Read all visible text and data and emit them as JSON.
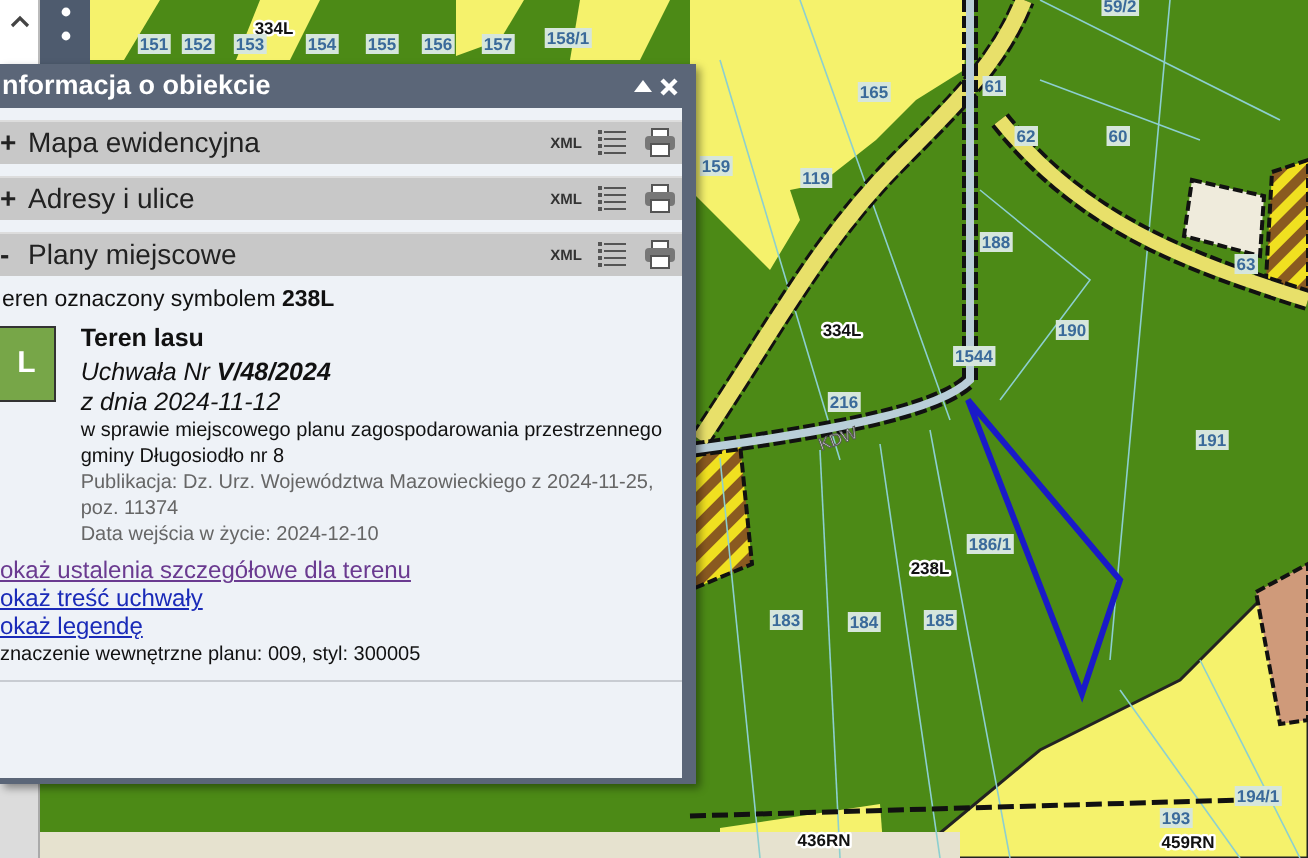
{
  "panel": {
    "title": "nformacja o obiekcie",
    "sections": [
      {
        "toggle": "+",
        "title": "Mapa ewidencyjna",
        "xml": "XML"
      },
      {
        "toggle": "+",
        "title": "Adresy i ulice",
        "xml": "XML"
      },
      {
        "toggle": "-",
        "title": "Plany miejscowe",
        "xml": "XML",
        "content": {
          "intro": "eren oznaczony symbolem **238L**",
          "symbol": "L",
          "name": "Teren lasu",
          "resolution": "Uchwała Nr **V/48/2024**",
          "date": "z dnia 2024-11-12",
          "subject": "w sprawie miejscowego planu zagospodarowania przestrzennego gminy Długosiodło nr 8",
          "publication": "Publikacja: Dz. Urz. Województwa Mazowieckiego z 2024-11-25, poz. 11374",
          "in_force": "Data wejścia w życie: 2024-12-10",
          "links": [
            {
              "text": "okaż ustalenia szczegółowe dla terenu",
              "visited": true
            },
            {
              "text": "okaż treść uchwały",
              "visited": false
            },
            {
              "text": "okaż legendę",
              "visited": false
            }
          ],
          "note": "znaczenie wewnętrzne planu: 009, styl: 300005"
        }
      }
    ]
  },
  "map": {
    "labels": [
      {
        "text": "334L",
        "kind": "zone"
      },
      {
        "text": "151",
        "kind": "parcel"
      },
      {
        "text": "152",
        "kind": "parcel"
      },
      {
        "text": "153",
        "kind": "parcel"
      },
      {
        "text": "154",
        "kind": "parcel"
      },
      {
        "text": "155",
        "kind": "parcel"
      },
      {
        "text": "156",
        "kind": "parcel"
      },
      {
        "text": "157",
        "kind": "parcel"
      },
      {
        "text": "158/1",
        "kind": "parcel"
      },
      {
        "text": "59/2",
        "kind": "parcel"
      },
      {
        "text": "165",
        "kind": "parcel"
      },
      {
        "text": "61",
        "kind": "parcel"
      },
      {
        "text": "62",
        "kind": "parcel"
      },
      {
        "text": "60",
        "kind": "parcel"
      },
      {
        "text": "159",
        "kind": "parcel"
      },
      {
        "text": "119",
        "kind": "parcel"
      },
      {
        "text": "63",
        "kind": "parcel"
      },
      {
        "text": "188",
        "kind": "parcel"
      },
      {
        "text": "334L",
        "kind": "zone"
      },
      {
        "text": "190",
        "kind": "parcel"
      },
      {
        "text": "1544",
        "kind": "parcel"
      },
      {
        "text": "216",
        "kind": "parcel"
      },
      {
        "text": "KDW",
        "kind": "road"
      },
      {
        "text": "191",
        "kind": "parcel"
      },
      {
        "text": "186/1",
        "kind": "parcel"
      },
      {
        "text": "238L",
        "kind": "zone"
      },
      {
        "text": "183",
        "kind": "parcel"
      },
      {
        "text": "184",
        "kind": "parcel"
      },
      {
        "text": "185",
        "kind": "parcel"
      },
      {
        "text": "194/1",
        "kind": "parcel"
      },
      {
        "text": "436RN",
        "kind": "zone"
      },
      {
        "text": "193",
        "kind": "parcel"
      },
      {
        "text": "459RN",
        "kind": "zone"
      }
    ]
  }
}
